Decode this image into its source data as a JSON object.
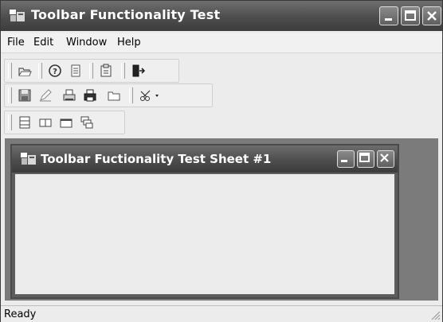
{
  "window": {
    "title": "Toolbar Functionality Test",
    "controls": [
      "minimize",
      "maximize",
      "close"
    ]
  },
  "menu": {
    "items": [
      "File",
      "Edit",
      "Window",
      "Help"
    ]
  },
  "toolbars": [
    {
      "buttons": [
        "open-folder-icon",
        "help-icon",
        "document-icon",
        "clipboard-icon",
        "exit-door-icon"
      ]
    },
    {
      "buttons": [
        "save-icon",
        "pencil-icon",
        "print-preview-icon",
        "printer-icon",
        "folder-icon",
        "scissors-icon"
      ]
    },
    {
      "buttons": [
        "tile-horizontal-icon",
        "tile-vertical-icon",
        "single-window-icon",
        "cascade-icon"
      ]
    }
  ],
  "child_window": {
    "title": "Toolbar Fuctionality Test Sheet #1"
  },
  "status": {
    "text": "Ready"
  },
  "colors": {
    "titlebar": "#4d4d4d",
    "workspace": "#7b7b7b",
    "face": "#ececec"
  }
}
